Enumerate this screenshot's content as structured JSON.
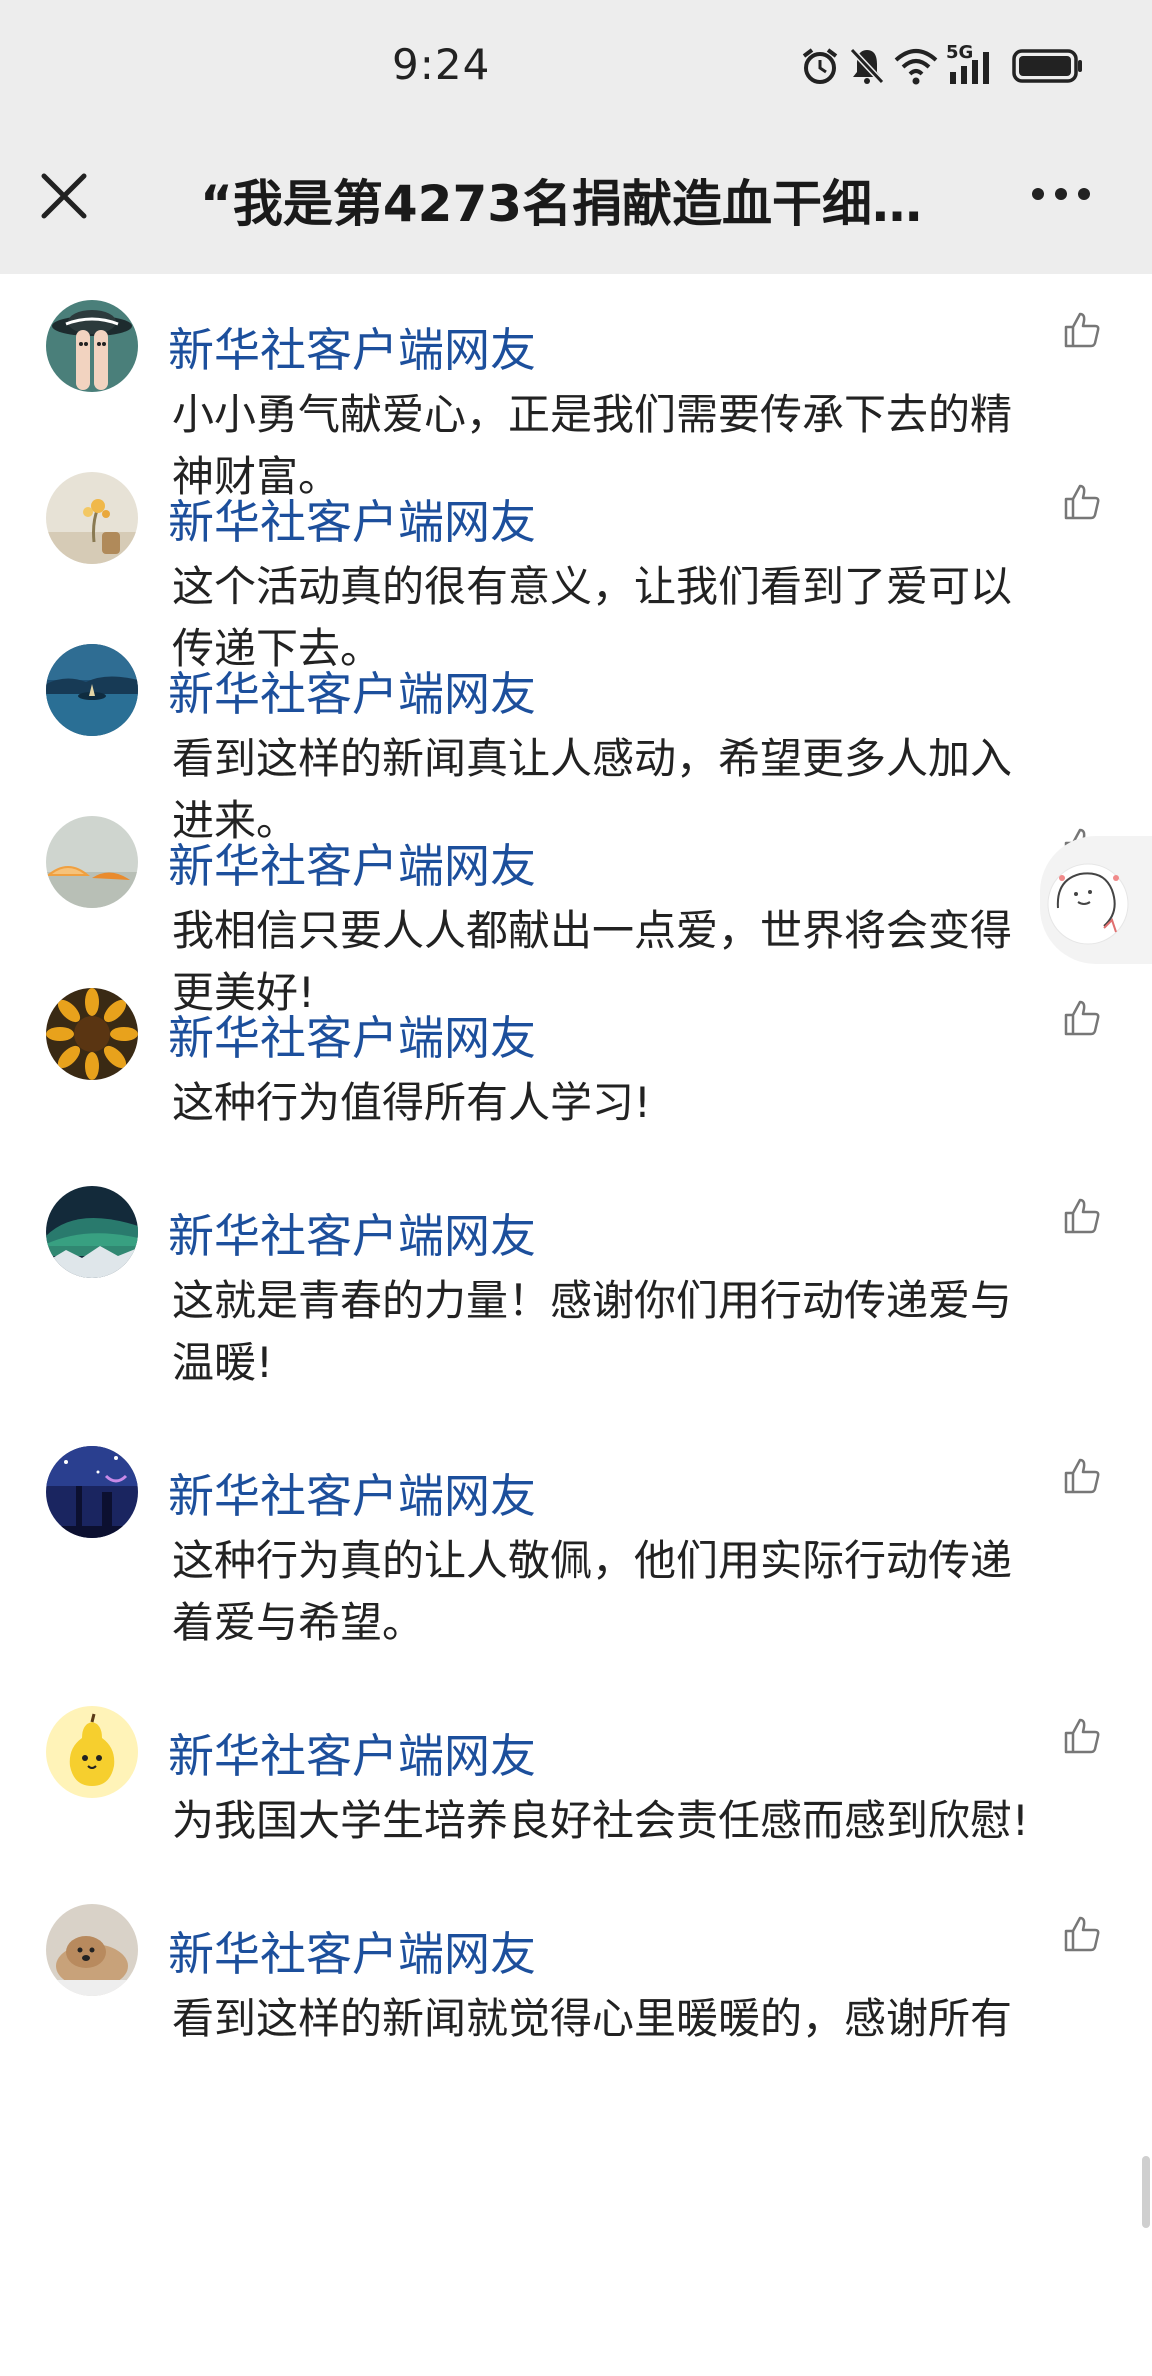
{
  "status_bar": {
    "time": "9:24",
    "network": "5G",
    "icons": [
      "alarm-icon",
      "mute-icon",
      "wifi-icon",
      "signal-icon",
      "battery-icon"
    ]
  },
  "header": {
    "title": "“我是第4273名捐献造血干细…",
    "close_icon": "close-icon",
    "more_icon": "more-icon"
  },
  "comments": [
    {
      "user": "新华社客户端网友",
      "text": "小小勇气献爱心，正是我们需要传承下去的精神财富。",
      "avatar": "avatar-fingers"
    },
    {
      "user": "新华社客户端网友",
      "text": "这个活动真的很有意义，让我们看到了爱可以传递下去。",
      "avatar": "avatar-flower"
    },
    {
      "user": "新华社客户端网友",
      "text": "看到这样的新闻真让人感动，希望更多人加入进来。",
      "avatar": "avatar-lake"
    },
    {
      "user": "新华社客户端网友",
      "text": "我相信只要人人都献出一点爱，世界将会变得更美好!",
      "avatar": "avatar-orange"
    },
    {
      "user": "新华社客户端网友",
      "text": "这种行为值得所有人学习!",
      "avatar": "avatar-sunflower"
    },
    {
      "user": "新华社客户端网友",
      "text": "这就是青春的力量！感谢你们用行动传递爱与温暖!",
      "avatar": "avatar-aurora"
    },
    {
      "user": "新华社客户端网友",
      "text": "这种行为真的让人敬佩，他们用实际行动传递着爱与希望。",
      "avatar": "avatar-night"
    },
    {
      "user": "新华社客户端网友",
      "text": "为我国大学生培养良好社会责任感而感到欣慰!",
      "avatar": "avatar-pear"
    },
    {
      "user": "新华社客户端网友",
      "text": "看到这样的新闻就觉得心里暖暖的，感谢所有",
      "avatar": "avatar-dog"
    }
  ],
  "colors": {
    "header_bg": "#ededed",
    "username": "#1c4f9c",
    "text": "#222222"
  }
}
